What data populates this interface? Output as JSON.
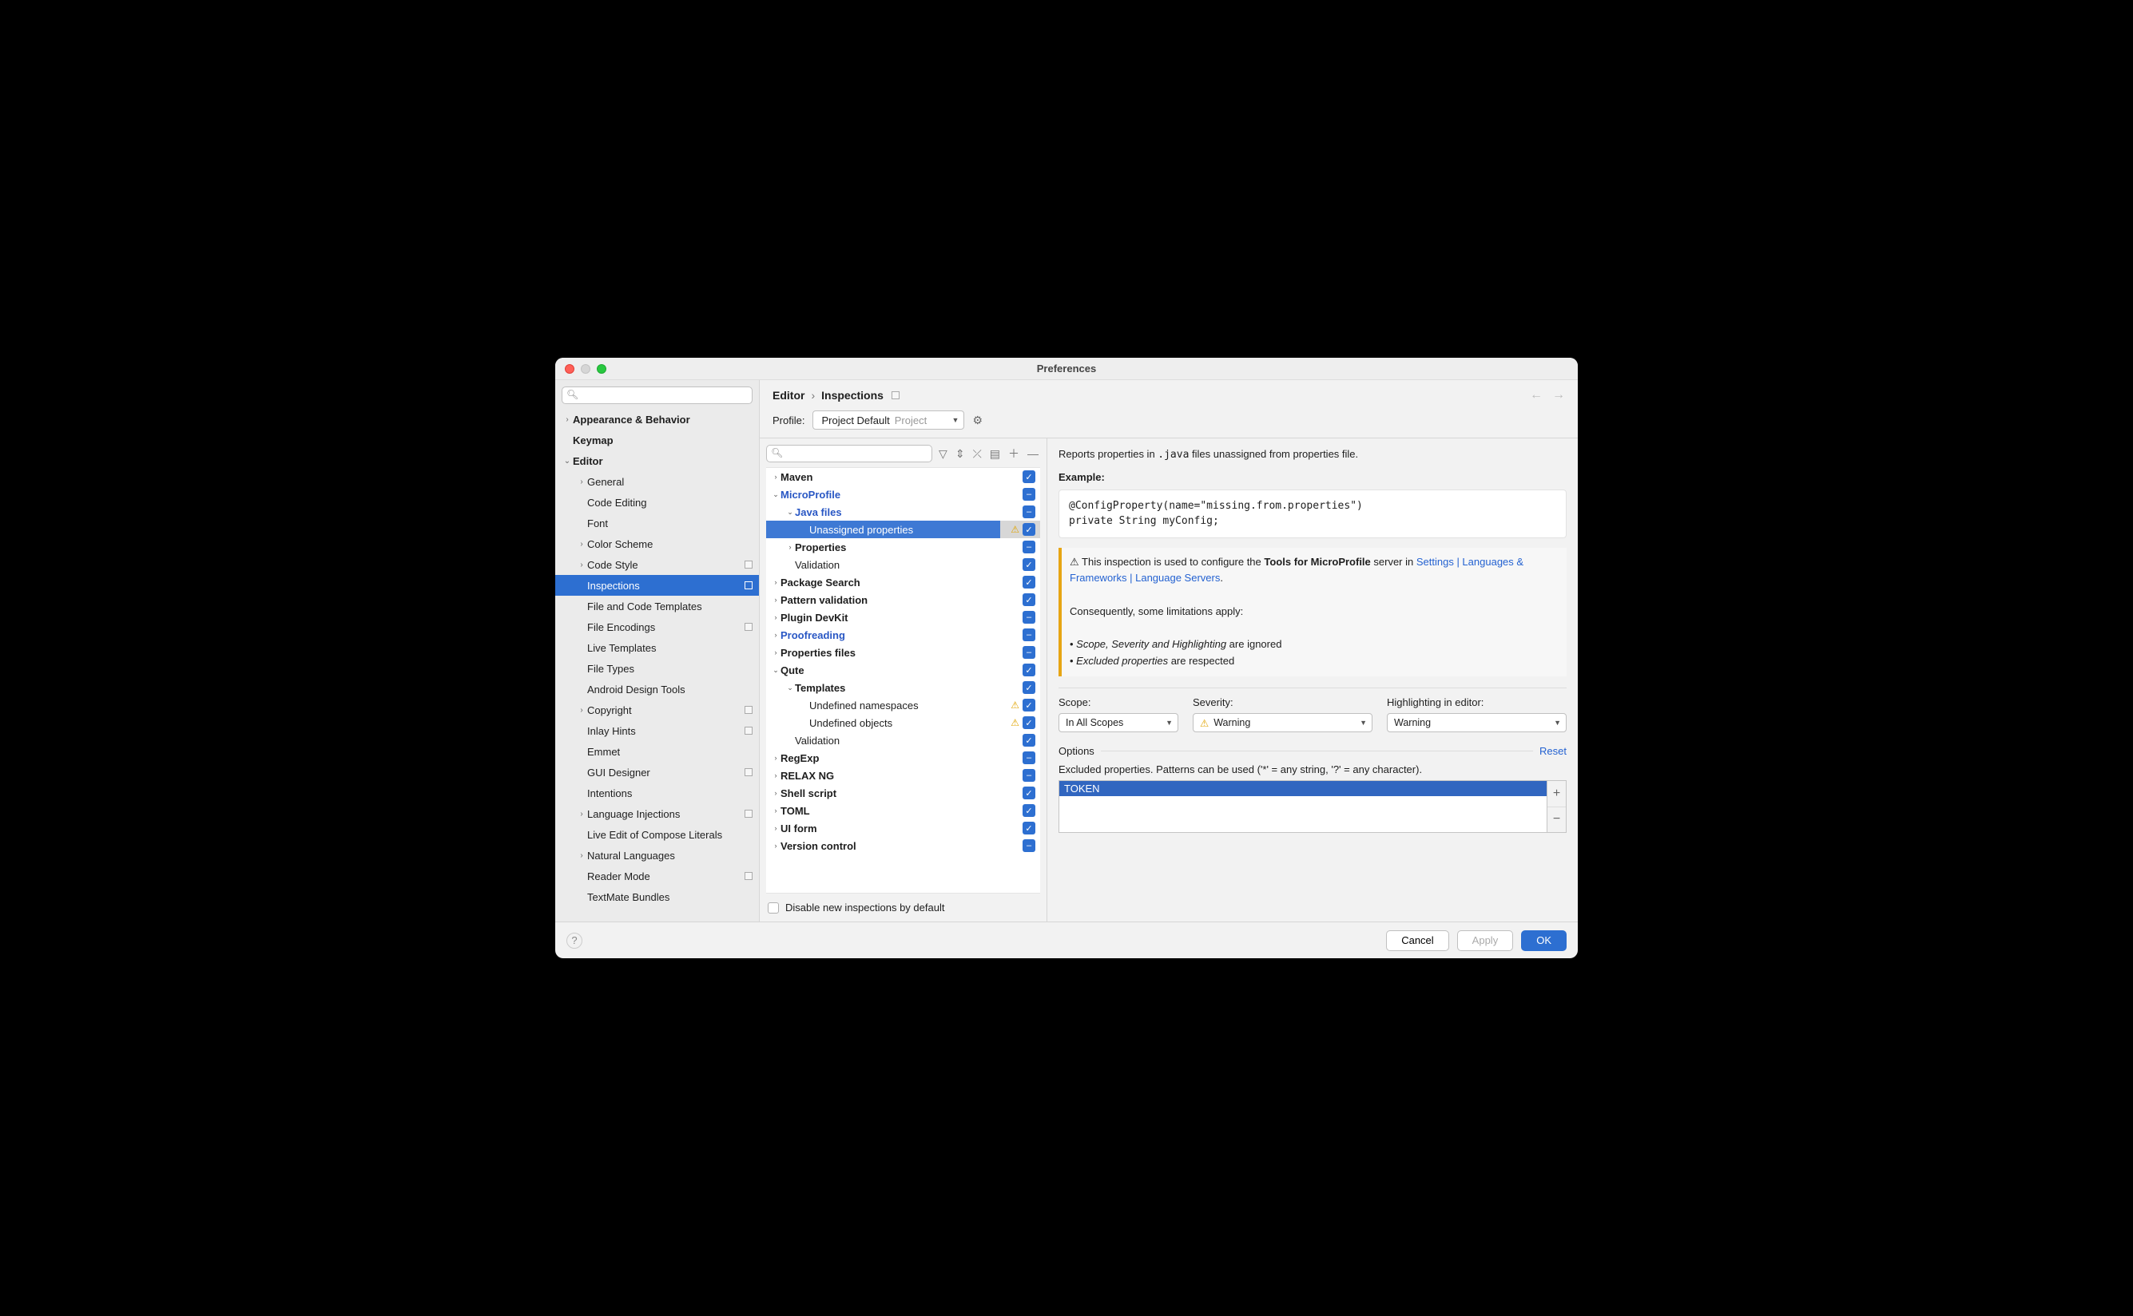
{
  "window": {
    "title": "Preferences"
  },
  "breadcrumb": {
    "a": "Editor",
    "b": "Inspections"
  },
  "profile": {
    "label": "Profile:",
    "value": "Project Default",
    "scope": "Project"
  },
  "sidebar_items": [
    {
      "label": "Appearance & Behavior",
      "level": 0,
      "caret": "›",
      "bold": true
    },
    {
      "label": "Keymap",
      "level": 0,
      "caret": "",
      "bold": true
    },
    {
      "label": "Editor",
      "level": 0,
      "caret": "⌄",
      "bold": true
    },
    {
      "label": "General",
      "level": 1,
      "caret": "›"
    },
    {
      "label": "Code Editing",
      "level": 1,
      "caret": ""
    },
    {
      "label": "Font",
      "level": 1,
      "caret": ""
    },
    {
      "label": "Color Scheme",
      "level": 1,
      "caret": "›"
    },
    {
      "label": "Code Style",
      "level": 1,
      "caret": "›",
      "badge": true
    },
    {
      "label": "Inspections",
      "level": 1,
      "caret": "",
      "badge": true,
      "selected": true
    },
    {
      "label": "File and Code Templates",
      "level": 1,
      "caret": ""
    },
    {
      "label": "File Encodings",
      "level": 1,
      "caret": "",
      "badge": true
    },
    {
      "label": "Live Templates",
      "level": 1,
      "caret": ""
    },
    {
      "label": "File Types",
      "level": 1,
      "caret": ""
    },
    {
      "label": "Android Design Tools",
      "level": 1,
      "caret": ""
    },
    {
      "label": "Copyright",
      "level": 1,
      "caret": "›",
      "badge": true
    },
    {
      "label": "Inlay Hints",
      "level": 1,
      "caret": "",
      "badge": true
    },
    {
      "label": "Emmet",
      "level": 1,
      "caret": ""
    },
    {
      "label": "GUI Designer",
      "level": 1,
      "caret": "",
      "badge": true
    },
    {
      "label": "Intentions",
      "level": 1,
      "caret": ""
    },
    {
      "label": "Language Injections",
      "level": 1,
      "caret": "›",
      "badge": true
    },
    {
      "label": "Live Edit of Compose Literals",
      "level": 1,
      "caret": ""
    },
    {
      "label": "Natural Languages",
      "level": 1,
      "caret": "›"
    },
    {
      "label": "Reader Mode",
      "level": 1,
      "caret": "",
      "badge": true
    },
    {
      "label": "TextMate Bundles",
      "level": 1,
      "caret": ""
    }
  ],
  "inspections": [
    {
      "name": "Maven",
      "level": 0,
      "caret": "›",
      "bold": true,
      "chk": "checked"
    },
    {
      "name": "MicroProfile",
      "level": 0,
      "caret": "⌄",
      "blue": true,
      "chk": "partial"
    },
    {
      "name": "Java files",
      "level": 1,
      "caret": "⌄",
      "blue": true,
      "chk": "partial"
    },
    {
      "name": "Unassigned properties",
      "level": 2,
      "caret": "",
      "chk": "checked",
      "warn": true,
      "selected": true
    },
    {
      "name": "Properties",
      "level": 1,
      "caret": "›",
      "bold": true,
      "chk": "partial"
    },
    {
      "name": "Validation",
      "level": 1,
      "caret": "",
      "chk": "checked"
    },
    {
      "name": "Package Search",
      "level": 0,
      "caret": "›",
      "bold": true,
      "chk": "checked"
    },
    {
      "name": "Pattern validation",
      "level": 0,
      "caret": "›",
      "bold": true,
      "chk": "checked"
    },
    {
      "name": "Plugin DevKit",
      "level": 0,
      "caret": "›",
      "bold": true,
      "chk": "partial"
    },
    {
      "name": "Proofreading",
      "level": 0,
      "caret": "›",
      "blue": true,
      "chk": "partial"
    },
    {
      "name": "Properties files",
      "level": 0,
      "caret": "›",
      "bold": true,
      "chk": "partial"
    },
    {
      "name": "Qute",
      "level": 0,
      "caret": "⌄",
      "bold": true,
      "chk": "checked"
    },
    {
      "name": "Templates",
      "level": 1,
      "caret": "⌄",
      "bold": true,
      "chk": "checked"
    },
    {
      "name": "Undefined namespaces",
      "level": 2,
      "caret": "",
      "chk": "checked",
      "warn": true
    },
    {
      "name": "Undefined objects",
      "level": 2,
      "caret": "",
      "chk": "checked",
      "warn": true
    },
    {
      "name": "Validation",
      "level": 1,
      "caret": "",
      "chk": "checked"
    },
    {
      "name": "RegExp",
      "level": 0,
      "caret": "›",
      "bold": true,
      "chk": "partial"
    },
    {
      "name": "RELAX NG",
      "level": 0,
      "caret": "›",
      "bold": true,
      "chk": "partial"
    },
    {
      "name": "Shell script",
      "level": 0,
      "caret": "›",
      "bold": true,
      "chk": "checked"
    },
    {
      "name": "TOML",
      "level": 0,
      "caret": "›",
      "bold": true,
      "chk": "checked"
    },
    {
      "name": "UI form",
      "level": 0,
      "caret": "›",
      "bold": true,
      "chk": "checked"
    },
    {
      "name": "Version control",
      "level": 0,
      "caret": "›",
      "bold": true,
      "chk": "partial"
    }
  ],
  "disable_label": "Disable new inspections by default",
  "detail": {
    "report_pre": "Reports properties in ",
    "report_code": ".java",
    "report_post": " files unassigned from properties file.",
    "example": "Example:",
    "code": "@ConfigProperty(name=\"missing.from.properties\")\nprivate String myConfig;",
    "note_warn": "⚠",
    "note_pre": " This inspection is used to configure the ",
    "note_bold": "Tools for MicroProfile",
    "note_mid": " server in ",
    "note_link1": "Settings | Languages & Frameworks | Language Servers",
    "note_after": ".",
    "note_p2": "Consequently, some limitations apply:",
    "note_b1_i": "Scope, Severity and Highlighting",
    "note_b1_t": " are ignored",
    "note_b2_i": "Excluded properties",
    "note_b2_t": " are respected",
    "scope": {
      "label": "Scope:",
      "value": "In All Scopes"
    },
    "severity": {
      "label": "Severity:",
      "value": "Warning"
    },
    "highlight": {
      "label": "Highlighting in editor:",
      "value": "Warning"
    },
    "options": "Options",
    "reset": "Reset",
    "excluded_label": "Excluded properties. Patterns can be used ('*' = any string, '?' = any character).",
    "excluded_item": "TOKEN"
  },
  "footer": {
    "cancel": "Cancel",
    "apply": "Apply",
    "ok": "OK"
  }
}
